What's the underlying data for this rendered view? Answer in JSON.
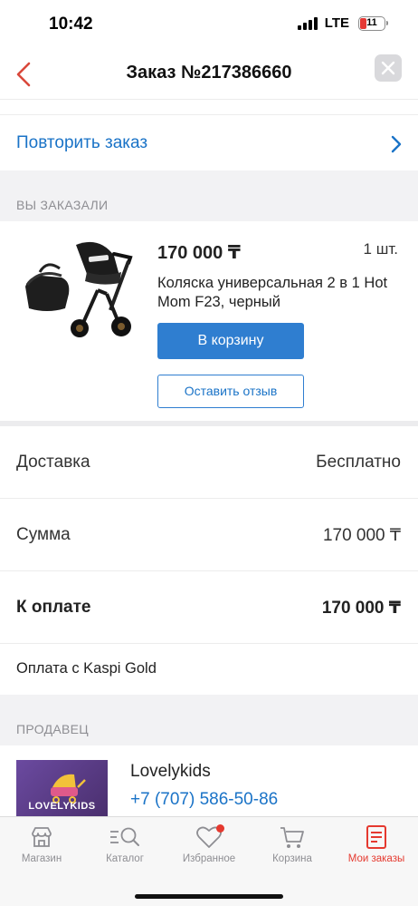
{
  "status_bar": {
    "time": "10:42",
    "network": "LTE",
    "battery": "11"
  },
  "header": {
    "title": "Заказ №217386660",
    "back_icon": "chevron-left-icon",
    "close_icon": "close-icon"
  },
  "repeat_order": {
    "label": "Повторить заказ"
  },
  "ordered_section": {
    "title": "ВЫ ЗАКАЗАЛИ"
  },
  "product": {
    "price": "170 000 ₸",
    "quantity": "1 шт.",
    "name": "Коляска универсальная 2 в 1 Hot Mom F23, черный",
    "add_to_cart": "В корзину",
    "leave_review": "Оставить отзыв"
  },
  "summary": {
    "delivery_label": "Доставка",
    "delivery_value": "Бесплатно",
    "sum_label": "Сумма",
    "sum_value": "170 000 ₸",
    "to_pay_label": "К оплате",
    "to_pay_value": "170 000 ₸",
    "payment_method": "Оплата с Kaspi Gold"
  },
  "seller_section": {
    "title": "ПРОДАВЕЦ"
  },
  "seller": {
    "name": "Lovelykids",
    "phone": "+7 (707) 586-50-86",
    "logo_text": "LOVELYKIDS"
  },
  "tabbar": {
    "items": [
      {
        "label": "Магазин",
        "icon": "shop-icon"
      },
      {
        "label": "Каталог",
        "icon": "catalog-search-icon"
      },
      {
        "label": "Избранное",
        "icon": "heart-icon"
      },
      {
        "label": "Корзина",
        "icon": "cart-icon"
      },
      {
        "label": "Мои заказы",
        "icon": "orders-icon"
      }
    ],
    "active_index": 4
  },
  "colors": {
    "accent": "#1a73c7",
    "active_tab": "#e5392f",
    "button": "#2f7ed0"
  }
}
